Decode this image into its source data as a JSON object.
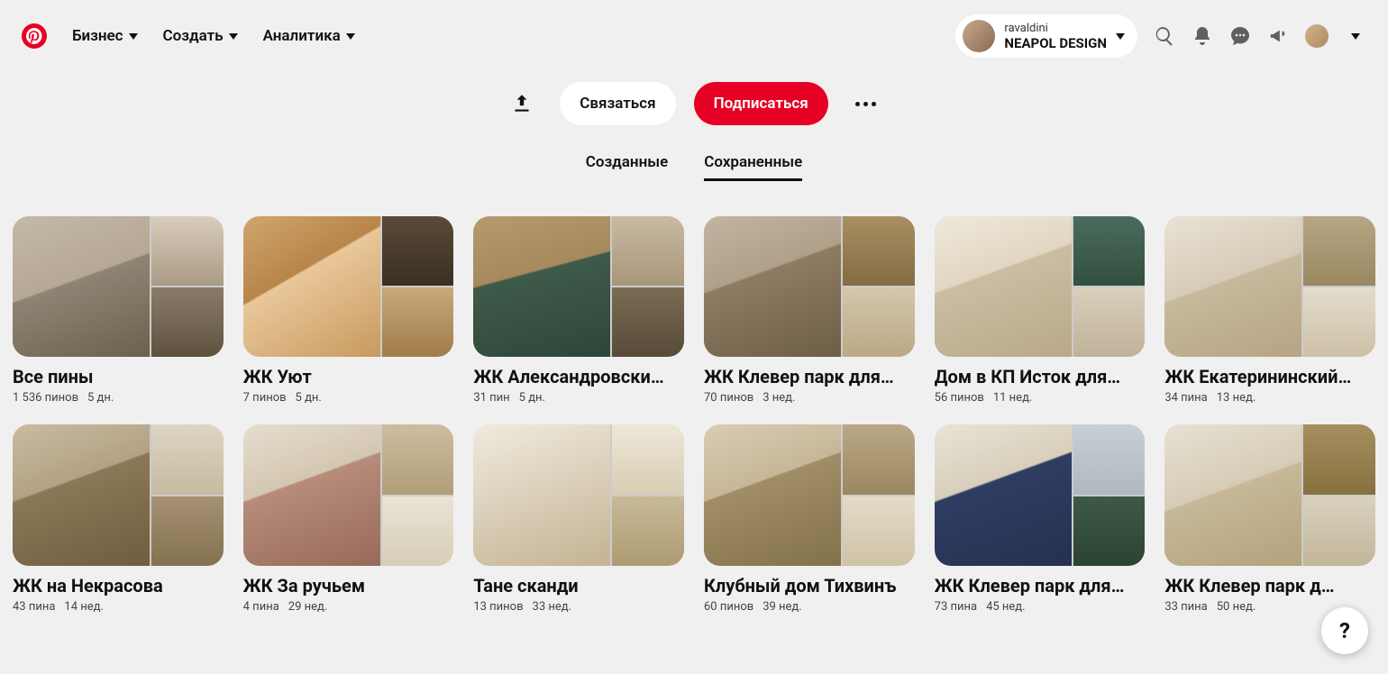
{
  "header": {
    "nav": {
      "business": "Бизнес",
      "create": "Создать",
      "analytics": "Аналитика"
    },
    "account": {
      "username": "ravaldini",
      "brand": "NEAPOL DESIGN"
    }
  },
  "profileActions": {
    "contact": "Связаться",
    "subscribe": "Подписаться"
  },
  "tabs": {
    "created": "Созданные",
    "saved": "Сохраненные"
  },
  "boards": [
    {
      "title": "Все пины",
      "pins": "1 536 пинов",
      "age": "5 дн."
    },
    {
      "title": "ЖК Уют",
      "pins": "7 пинов",
      "age": "5 дн."
    },
    {
      "title": "ЖК Александровски…",
      "pins": "31 пин",
      "age": "5 дн."
    },
    {
      "title": "ЖК Клевер парк для…",
      "pins": "70 пинов",
      "age": "3 нед."
    },
    {
      "title": "Дом в КП Исток для…",
      "pins": "56 пинов",
      "age": "11 нед."
    },
    {
      "title": "ЖК Екатерининский…",
      "pins": "34 пина",
      "age": "13 нед."
    },
    {
      "title": "ЖК на Некрасова",
      "pins": "43 пина",
      "age": "14 нед."
    },
    {
      "title": "ЖК За ручьем",
      "pins": "4 пина",
      "age": "29 нед."
    },
    {
      "title": "Тане сканди",
      "pins": "13 пинов",
      "age": "33 нед."
    },
    {
      "title": "Клубный дом Тихвинъ",
      "pins": "60 пинов",
      "age": "39 нед."
    },
    {
      "title": "ЖК Клевер парк для…",
      "pins": "73 пина",
      "age": "45 нед."
    },
    {
      "title": "ЖК Клевер парк д…",
      "pins": "33 пина",
      "age": "50 нед."
    }
  ],
  "help": "?"
}
